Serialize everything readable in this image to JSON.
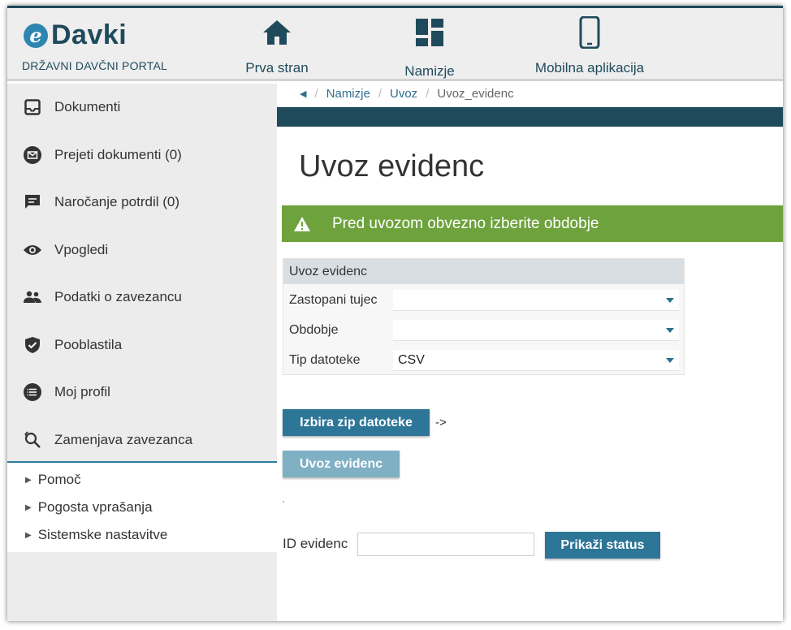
{
  "header": {
    "logo_mark": "e",
    "logo_text": "Davki",
    "logo_subtitle": "DRŽAVNI DAVČNI PORTAL",
    "nav": [
      {
        "label": "Prva stran",
        "icon": "home-icon"
      },
      {
        "label": "Namizje",
        "icon": "dashboard-icon"
      },
      {
        "label": "Mobilna aplikacija",
        "icon": "mobile-phone-icon"
      }
    ]
  },
  "sidebar": {
    "items": [
      {
        "label": "Dokumenti",
        "icon": "inbox-icon"
      },
      {
        "label": "Prejeti dokumenti (0)",
        "icon": "mail-circle-icon"
      },
      {
        "label": "Naročanje potrdil (0)",
        "icon": "comment-icon"
      },
      {
        "label": "Vpogledi",
        "icon": "eye-icon"
      },
      {
        "label": "Podatki o zavezancu",
        "icon": "people-icon"
      },
      {
        "label": "Pooblastila",
        "icon": "shield-check-icon"
      },
      {
        "label": "Moj profil",
        "icon": "list-circle-icon"
      },
      {
        "label": "Zamenjava zavezanca",
        "icon": "person-search-icon"
      }
    ],
    "sub_items": [
      {
        "label": "Pomoč"
      },
      {
        "label": "Pogosta vprašanja"
      },
      {
        "label": "Sistemske nastavitve"
      }
    ]
  },
  "breadcrumb": {
    "items": [
      "Namizje",
      "Uvoz",
      "Uvoz_evidenc"
    ]
  },
  "main": {
    "title": "Uvoz evidenc",
    "alert": "Pred uvozom obvezno izberite obdobje",
    "form": {
      "heading": "Uvoz evidenc",
      "fields": [
        {
          "label": "Zastopani tujec",
          "value": ""
        },
        {
          "label": "Obdobje",
          "value": ""
        },
        {
          "label": "Tip datoteke",
          "value": "CSV"
        }
      ]
    },
    "choose_zip_button": "Izbira zip datoteke",
    "choose_zip_arrow": "->",
    "import_button": "Uvoz evidenc",
    "id_label": "ID evidenc",
    "id_value": "",
    "status_button": "Prikaži status"
  },
  "colors": {
    "brand_dark": "#1f4a5c",
    "brand_blue": "#2d7697",
    "alert_green": "#6ea23d"
  }
}
